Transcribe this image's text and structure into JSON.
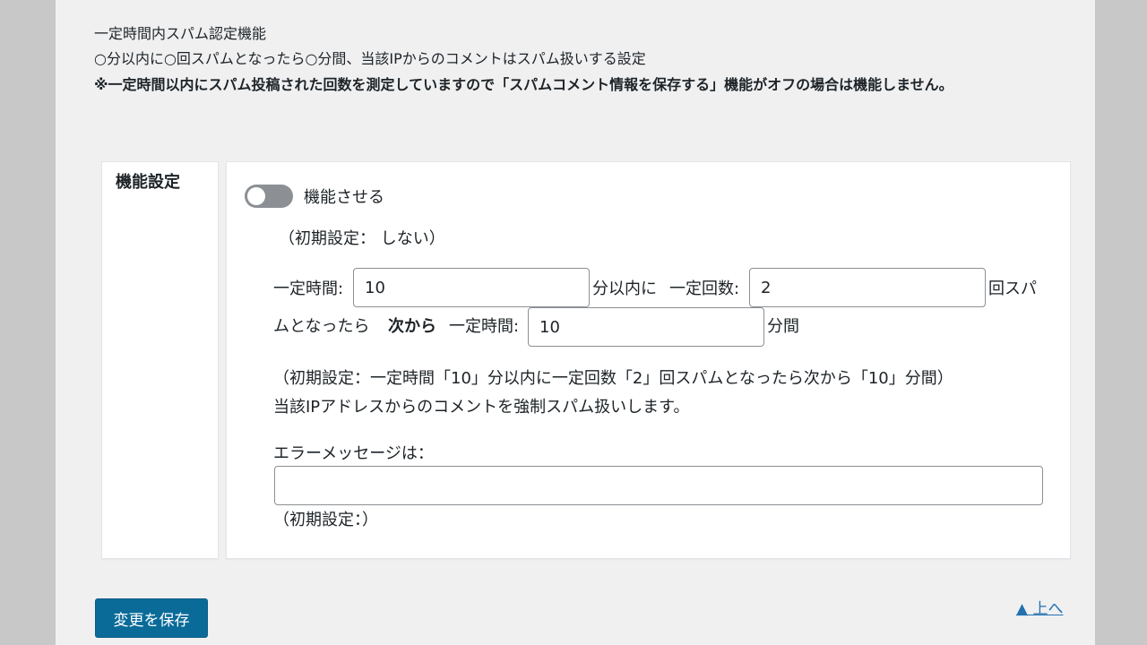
{
  "intro": {
    "title": "一定時間内スパム認定機能",
    "desc": "○分以内に○回スパムとなったら○分間、当該IPからのコメントはスパム扱いする設定",
    "warning": "※一定時間以内にスパム投稿された回数を測定していますので「スパムコメント情報を保存する」機能がオフの場合は機能しません。"
  },
  "setting": {
    "label": "機能設定",
    "toggle": {
      "label": "機能させる",
      "state": "off"
    },
    "toggle_default": "（初期設定： しない）",
    "row1": {
      "time_label": "一定時間:",
      "time_value": "10",
      "within_label": "分以内に",
      "count_label": "一定回数:",
      "count_value": "2",
      "spam_wrap": "回スパ"
    },
    "row2": {
      "became": "ムとなったら",
      "next": "次から",
      "time_label": "一定時間:",
      "time_value": "10",
      "minutes": "分間"
    },
    "default_line1": "（初期設定：一定時間「10」分以内に一定回数「2」回スパムとなったら次から「10」分間）",
    "default_line2": "当該IPアドレスからのコメントを強制スパム扱いします。",
    "error_label": "エラーメッセージは：",
    "error_value": "",
    "error_default": "（初期設定：）"
  },
  "footer": {
    "save_label": "変更を保存",
    "top_link": "▲ 上へ"
  },
  "colors": {
    "accent": "#0a6b99",
    "link": "#2271b1",
    "toggle_off": "#8c8f94"
  }
}
